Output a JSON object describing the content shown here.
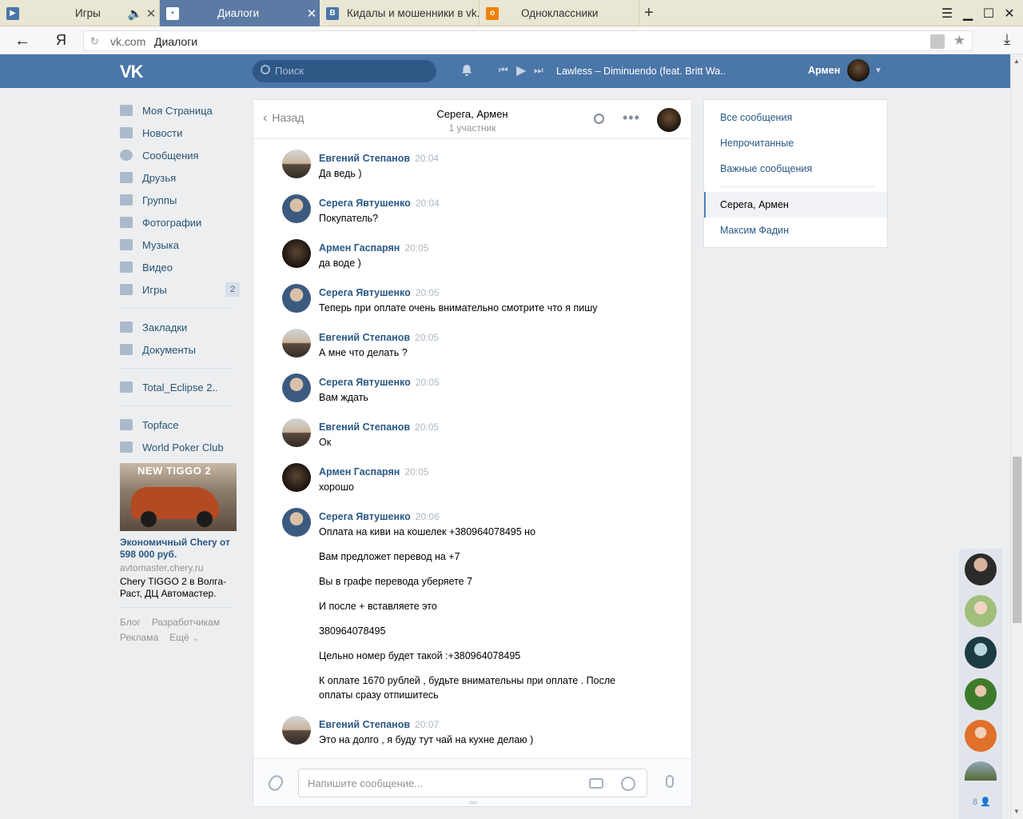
{
  "browser": {
    "tabs": [
      {
        "title": "Игры",
        "icon": "play-icon"
      },
      {
        "title": "Диалоги",
        "icon": "vk-messages-icon"
      },
      {
        "title": "Кидалы и мошенники в vk.c",
        "icon": "vk-icon"
      },
      {
        "title": "Одноклассники",
        "icon": "ok-icon"
      }
    ],
    "new_tab": "+",
    "address_brand": "Я",
    "url_domain": "vk.com",
    "url_page": "Диалоги"
  },
  "header": {
    "search_placeholder": "Поиск",
    "track": "Lawless – Diminuendo (feat. Britt Wa..",
    "user_name": "Армен"
  },
  "nav": {
    "items": [
      {
        "label": "Моя Страница",
        "icon": "home-icon"
      },
      {
        "label": "Новости",
        "icon": "news-icon"
      },
      {
        "label": "Сообщения",
        "icon": "messages-icon"
      },
      {
        "label": "Друзья",
        "icon": "friends-icon"
      },
      {
        "label": "Группы",
        "icon": "groups-icon"
      },
      {
        "label": "Фотографии",
        "icon": "camera-icon"
      },
      {
        "label": "Музыка",
        "icon": "music-icon"
      },
      {
        "label": "Видео",
        "icon": "video-icon"
      },
      {
        "label": "Игры",
        "icon": "games-icon",
        "badge": "2"
      }
    ],
    "items2": [
      {
        "label": "Закладки",
        "icon": "star-icon"
      },
      {
        "label": "Документы",
        "icon": "document-icon"
      }
    ],
    "group": {
      "label": "Total_Eclipse 2..",
      "icon": "group-icon"
    },
    "apps": [
      {
        "label": "Topface",
        "icon": "app-grid-icon"
      },
      {
        "label": "World Poker Club",
        "icon": "app-icon"
      }
    ],
    "ad": {
      "brand_text": "NEW TIGGO 2",
      "title": "Экономичный Chery от 598 000 руб.",
      "domain": "avtomaster.chery.ru",
      "desc": "Chery TIGGO 2 в Волга-Раст, ДЦ Автомастер."
    },
    "footer": {
      "blog": "Блог",
      "dev": "Разработчикам",
      "ads": "Реклама",
      "more": "Ещё"
    }
  },
  "chat": {
    "back": "Назад",
    "title": "Серега, Армен",
    "subtitle": "1 участник",
    "messages": [
      {
        "name": "Евгений Степанов",
        "time": "20:04",
        "text": [
          "Да ведь )"
        ]
      },
      {
        "name": "Серега Явтушенко",
        "time": "20:04",
        "text": [
          "Покупатель?"
        ]
      },
      {
        "name": "Армен Гаспарян",
        "time": "20:05",
        "text": [
          "да воде )"
        ]
      },
      {
        "name": "Серега Явтушенко",
        "time": "20:05",
        "text": [
          "Теперь при оплате очень внимательно смотрите что я пишу"
        ]
      },
      {
        "name": "Евгений Степанов",
        "time": "20:05",
        "text": [
          "А мне что делать ?"
        ]
      },
      {
        "name": "Серега Явтушенко",
        "time": "20:05",
        "text": [
          "Вам ждать"
        ]
      },
      {
        "name": "Евгений Степанов",
        "time": "20:05",
        "text": [
          "Ок"
        ]
      },
      {
        "name": "Армен Гаспарян",
        "time": "20:05",
        "text": [
          "хорошо"
        ]
      },
      {
        "name": "Серега Явтушенко",
        "time": "20:06",
        "text": [
          "Оплата на киви на кошелек +380964078495 но",
          "Вам предложет перевод на +7",
          "Вы в графе перевода уберяете 7",
          "И после + вставляете это",
          "380964078495",
          "Цельно номер будет такой :+380964078495",
          "К оплате 1670 рублей , будьте внимательны при оплате . После оплаты сразу отпишитесь"
        ]
      },
      {
        "name": "Евгений Степанов",
        "time": "20:07",
        "text": [
          "Это на долго , я буду тут чай на кухне делаю )"
        ]
      }
    ],
    "composer_placeholder": "Напишите сообщение..."
  },
  "right_menu": {
    "all": "Все сообщения",
    "unread": "Непрочитанные",
    "important": "Важные сообщения",
    "selected": "Серега, Армен",
    "other": "Максим Фадин"
  },
  "friends_strip": {
    "count": "8"
  }
}
